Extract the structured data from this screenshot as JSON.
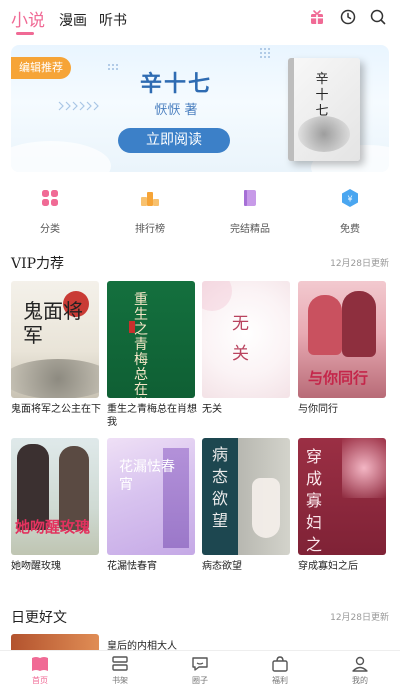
{
  "top_tabs": [
    "小说",
    "漫画",
    "听书"
  ],
  "banner": {
    "tag": "编辑推荐",
    "title": "辛十七",
    "author": "恹恹  著",
    "button": "立即阅读",
    "cover_title": "辛十七"
  },
  "categories": [
    {
      "label": "分类",
      "icon": "grid-icon",
      "color": "#f06a95"
    },
    {
      "label": "排行榜",
      "icon": "ranking-icon",
      "color": "#f6a437"
    },
    {
      "label": "完结精品",
      "icon": "book-icon",
      "color": "#b97be0"
    },
    {
      "label": "免费",
      "icon": "free-icon",
      "color": "#4aa6f0"
    }
  ],
  "vip": {
    "title": "VIP力荐",
    "updated": "12月28日更新",
    "books": [
      {
        "title": "鬼面将军之公主在下",
        "cover_text": "鬼面将军"
      },
      {
        "title": "重生之青梅总在肖想我",
        "cover_text": "重生之青梅总在肖想我"
      },
      {
        "title": "无关",
        "cover_text": "无关"
      },
      {
        "title": "与你同行",
        "cover_text": "与你同行"
      },
      {
        "title": "她吻醒玫瑰",
        "cover_text": "她吻醒玫瑰"
      },
      {
        "title": "花漏怯春宵",
        "cover_text": "花漏怯春宵"
      },
      {
        "title": "病态欲望",
        "cover_text": "病态欲望"
      },
      {
        "title": "穿成寡妇之后",
        "cover_text": "穿成寡妇之后"
      }
    ]
  },
  "daily": {
    "title": "日更好文",
    "updated": "12月28日更新",
    "first_book": "皇后的内相大人"
  },
  "bottom_nav": [
    "首页",
    "书架",
    "圈子",
    "福利",
    "我的"
  ],
  "colors": {
    "accent": "#f06a95",
    "banner_blue": "#3c80c8",
    "tag_orange": "#f6a437"
  }
}
